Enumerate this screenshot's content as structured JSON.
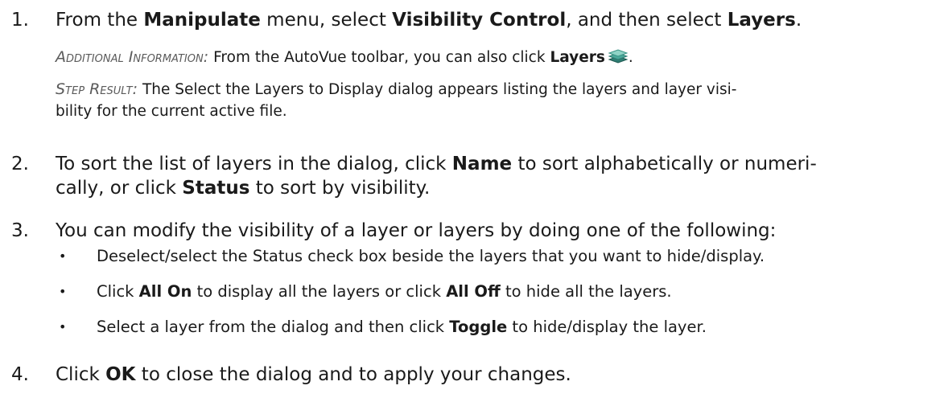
{
  "steps": [
    {
      "number": "1.",
      "parts": [
        "From the ",
        "Manipulate",
        " menu, select ",
        "Visibility Control",
        ", and then select ",
        "Layers",
        "."
      ],
      "additional_label": "Additional Information:",
      "additional_parts": [
        "From the AutoVue toolbar, you can also click ",
        "Layers",
        "."
      ],
      "result_label": "Step Result:",
      "result_line1": "The Select the Layers to Display dialog appears listing the layers and layer visi-",
      "result_line2": "bility for the current active file."
    },
    {
      "number": "2.",
      "line1_parts": [
        "To sort the list of layers in the dialog, click ",
        "Name",
        " to sort alphabetically or numeri-"
      ],
      "line2_parts": [
        "cally, or click ",
        "Status",
        " to sort by visibility."
      ]
    },
    {
      "number": "3.",
      "text": "You can modify the visibility of a layer or layers by doing one of the following:",
      "bullets": [
        {
          "parts": [
            "Deselect/select the Status check box beside the layers that you want to hide/display."
          ]
        },
        {
          "parts": [
            "Click ",
            "All On",
            " to display all the layers or click ",
            "All Off",
            " to hide all the layers."
          ]
        },
        {
          "parts": [
            "Select a layer from the dialog and then click ",
            "Toggle",
            " to hide/display the layer."
          ]
        }
      ]
    },
    {
      "number": "4.",
      "parts": [
        "Click ",
        "OK",
        " to close the dialog and to apply your changes."
      ]
    }
  ],
  "bullet_glyph": "•",
  "icons": {
    "layers": "layers-icon"
  }
}
